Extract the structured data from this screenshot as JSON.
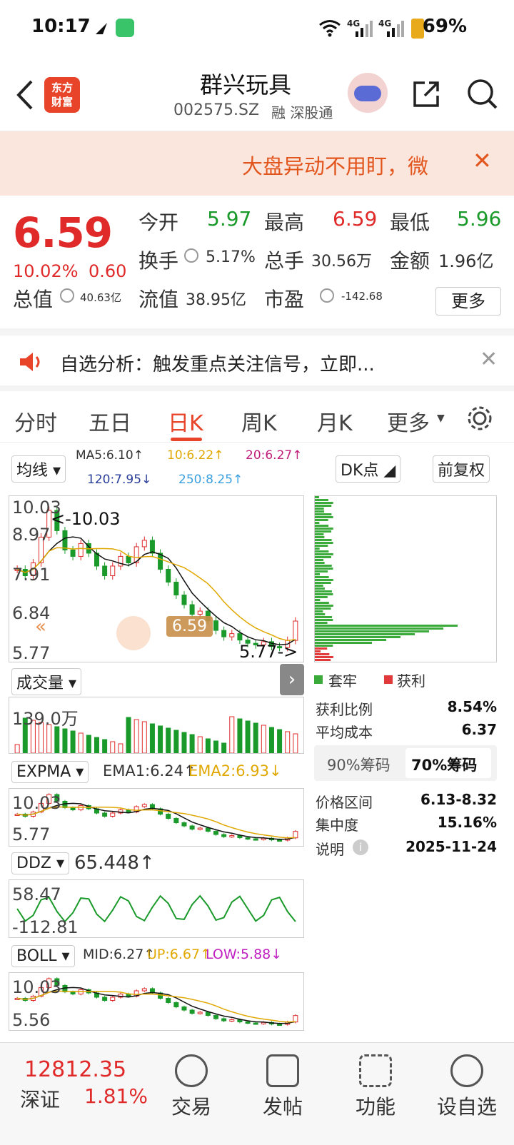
{
  "status": {
    "time": "10:17",
    "battery": "69%",
    "net1": "4G",
    "net2": "4G"
  },
  "header": {
    "logo": "东方\n财富",
    "title": "群兴玩具",
    "code": "002575.SZ",
    "tags": "融 深股通"
  },
  "banner": {
    "text": "大盘异动不用盯，微",
    "close": "✕"
  },
  "quote": {
    "price": "6.59",
    "pct": "10.02%",
    "chg": "0.60",
    "open_l": "今开",
    "open": "5.97",
    "high_l": "最高",
    "high": "6.59",
    "low_l": "最低",
    "low": "5.96",
    "turn_l": "换手",
    "turn": "5.17%",
    "vol_l": "总手",
    "vol": "30.56万",
    "amt_l": "金额",
    "amt": "1.96亿",
    "mcap_l": "总值",
    "mcap": "40.63亿",
    "flow_l": "流值",
    "flow": "38.95亿",
    "pe_l": "市盈",
    "pe": "-142.68",
    "more": "更多"
  },
  "notice": {
    "text": "自选分析：触发重点关注信号，立即...",
    "close": "✕"
  },
  "tabs": {
    "items": [
      "分时",
      "五日",
      "日K",
      "周K",
      "月K",
      "更多"
    ],
    "active": 2
  },
  "kline": {
    "type_btn": "均线",
    "ma5": "MA5:6.10↑",
    "ma10": "10:6.22↑",
    "ma20": "20:6.27↑",
    "ma120": "120:7.95↓",
    "ma250": "250:8.25↑",
    "dk_btn": "DK点",
    "fq_btn": "前复权",
    "max": "10.03",
    "y2": "8.97",
    "y3": "7.91",
    "y4": "6.84",
    "min": "5.77",
    "max_anno": "<-10.03",
    "min_anno": "5.77->",
    "cur_tag": "6.59"
  },
  "volume": {
    "btn": "成交量",
    "max": "139.0万"
  },
  "expma": {
    "btn": "EXPMA",
    "ema1": "EMA1:6.24↑",
    "ema2": "EMA2:6.93↓",
    "max": "10.03",
    "min": "5.77"
  },
  "ddz": {
    "btn": "DDZ",
    "value": "65.448↑",
    "max": "58.47",
    "min": "-112.81"
  },
  "boll": {
    "btn": "BOLL",
    "mid": "MID:6.27↑",
    "up": "UP:6.67↑",
    "low": "LOW:5.88↓",
    "max": "10.03",
    "min": "5.56"
  },
  "chips": {
    "legend_trap": "套牢",
    "legend_profit": "获利",
    "profit_ratio_l": "获利比例",
    "profit_ratio": "8.54%",
    "avg_cost_l": "平均成本",
    "avg_cost": "6.37",
    "tab90": "90%筹码",
    "tab70": "70%筹码",
    "range_l": "价格区间",
    "range": "6.13-8.32",
    "conc_l": "集中度",
    "conc": "15.16%",
    "note_l": "说明",
    "note_date": "2025-11-24"
  },
  "bottom": {
    "index_value": "12812.35",
    "index_name": "深证",
    "index_pct": "1.81%",
    "trade": "交易",
    "post": "发帖",
    "func": "功能",
    "watch": "设自选"
  },
  "colors": {
    "accent": "#e8442a",
    "up": "#e02a2a",
    "down": "#1a9a2a"
  },
  "chart_data": {
    "type": "candlestick",
    "ylim": [
      5.77,
      10.03
    ],
    "close": [
      8.2,
      8.0,
      8.4,
      9.2,
      10.03,
      9.4,
      8.8,
      8.6,
      9.0,
      8.7,
      8.3,
      8.0,
      8.3,
      8.6,
      8.4,
      8.9,
      9.1,
      8.7,
      8.2,
      7.8,
      7.4,
      7.1,
      6.8,
      6.9,
      6.6,
      6.3,
      6.1,
      6.2,
      6.0,
      5.9,
      5.85,
      5.95,
      5.8,
      5.77,
      5.99,
      6.59
    ]
  }
}
